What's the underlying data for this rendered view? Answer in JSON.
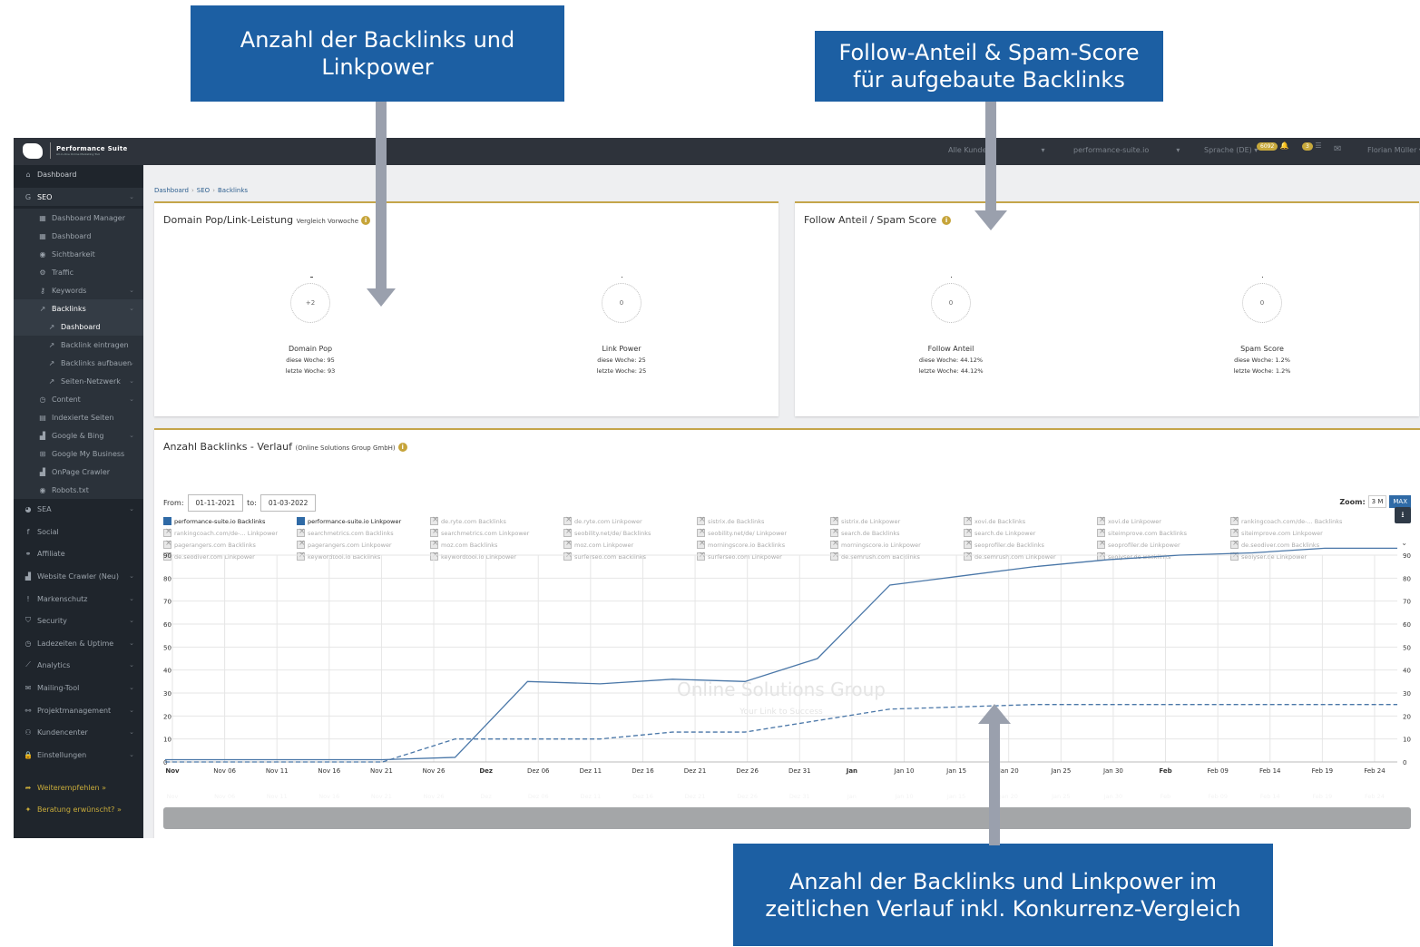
{
  "callouts": {
    "top_left": [
      "Anzahl der Backlinks und",
      "Linkpower"
    ],
    "top_right": [
      "Follow-Anteil & Spam-Score",
      "für aufgebaute Backlinks"
    ],
    "bottom": [
      "Anzahl der Backlinks und Linkpower im",
      "zeitlichen Verlauf inkl. Konkurrenz-Vergleich"
    ]
  },
  "topbar": {
    "logo_text": "Performance Suite",
    "logo_sub": "All-in-One Online Marketing Tool",
    "customer_select": "Alle Kunden",
    "domain_select": "performance-suite.io",
    "language": "Sprache (DE)",
    "badge_count": "6092",
    "badge_count2": "3",
    "user": "Florian Müller"
  },
  "sidebar": {
    "items": [
      {
        "label": "Dashboard",
        "icon": "home-icon"
      },
      {
        "label": "SEO",
        "icon": "google-icon"
      },
      {
        "label": "Dashboard Manager",
        "icon": "dashboard-icon"
      },
      {
        "label": "Dashboard",
        "icon": "dashboard-icon"
      },
      {
        "label": "Sichtbarkeit",
        "icon": "eye-icon"
      },
      {
        "label": "Traffic",
        "icon": "gears-icon"
      },
      {
        "label": "Keywords",
        "icon": "key-icon"
      },
      {
        "label": "Backlinks",
        "icon": "external-link-icon"
      },
      {
        "label": "Dashboard",
        "icon": "external-link-icon"
      },
      {
        "label": "Backlink eintragen",
        "icon": "external-link-icon"
      },
      {
        "label": "Backlinks aufbauen",
        "icon": "external-link-icon"
      },
      {
        "label": "Seiten-Netzwerk",
        "icon": "external-link-icon"
      },
      {
        "label": "Content",
        "icon": "clock-icon"
      },
      {
        "label": "Indexierte Seiten",
        "icon": "file-icon"
      },
      {
        "label": "Google & Bing",
        "icon": "area-chart-icon"
      },
      {
        "label": "Google My Business",
        "icon": "store-icon"
      },
      {
        "label": "OnPage Crawler",
        "icon": "area-chart-icon"
      },
      {
        "label": "Robots.txt",
        "icon": "eye-icon"
      },
      {
        "label": "SEA",
        "icon": "pie-icon"
      },
      {
        "label": "Social",
        "icon": "facebook-icon"
      },
      {
        "label": "Affiliate",
        "icon": "handshake-icon"
      },
      {
        "label": "Website Crawler (Neu)",
        "icon": "area-chart-icon"
      },
      {
        "label": "Markenschutz",
        "icon": "exclamation-icon"
      },
      {
        "label": "Security",
        "icon": "shield-icon"
      },
      {
        "label": "Ladezeiten & Uptime",
        "icon": "clock-icon"
      },
      {
        "label": "Analytics",
        "icon": "line-chart-icon"
      },
      {
        "label": "Mailing-Tool",
        "icon": "envelope-icon"
      },
      {
        "label": "Projektmanagement",
        "icon": "sitemap-icon"
      },
      {
        "label": "Kundencenter",
        "icon": "users-icon"
      },
      {
        "label": "Einstellungen",
        "icon": "lock-icon"
      },
      {
        "label": "Weiterempfehlen »",
        "icon": "share-icon"
      },
      {
        "label": "Beratung erwünscht? »",
        "icon": "chat-icon"
      }
    ]
  },
  "breadcrumb": [
    "Dashboard",
    "SEO",
    "Backlinks"
  ],
  "panel_linkpower": {
    "title": "Domain Pop/Link-Leistung",
    "subtitle": "Vergleich Vorwoche",
    "kpis": [
      {
        "gauge": "+2",
        "name": "Domain Pop",
        "this_week": "diese Woche: 95",
        "last_week": "letzte Woche: 93"
      },
      {
        "gauge": "0",
        "name": "Link Power",
        "this_week": "diese Woche: 25",
        "last_week": "letzte Woche: 25"
      }
    ]
  },
  "panel_follow": {
    "title": "Follow Anteil / Spam Score",
    "kpis": [
      {
        "gauge": "0",
        "name": "Follow Anteil",
        "this_week": "diese Woche: 44.12%",
        "last_week": "letzte Woche: 44.12%"
      },
      {
        "gauge": "0",
        "name": "Spam Score",
        "this_week": "diese Woche: 1.2%",
        "last_week": "letzte Woche: 1.2%"
      }
    ]
  },
  "panel_history": {
    "title": "Anzahl Backlinks - Verlauf",
    "subtitle": "(Online Solutions Group GmbH)",
    "from_label": "From:",
    "from_value": "01-11-2021",
    "to_label": "to:",
    "to_value": "01-03-2022",
    "zoom_label": "Zoom:",
    "zoom_options": [
      "3 M",
      "MAX"
    ],
    "watermark": "Online Solutions Group",
    "watermark_sub": "Your Link to Success",
    "legend": [
      "performance-suite.io Backlinks",
      "performance-suite.io Linkpower",
      "de.ryte.com Backlinks",
      "de.ryte.com Linkpower",
      "sistrix.de Backlinks",
      "sistrix.de Linkpower",
      "xovi.de Backlinks",
      "xovi.de Linkpower",
      "rankingcoach.com/de-... Backlinks",
      "rankingcoach.com/de-... Linkpower",
      "searchmetrics.com Backlinks",
      "searchmetrics.com Linkpower",
      "seobility.net/de/ Backlinks",
      "seobility.net/de/ Linkpower",
      "search.de Backlinks",
      "search.de Linkpower",
      "siteimprove.com Backlinks",
      "siteimprove.com Linkpower",
      "pagerangers.com Backlinks",
      "pagerangers.com Linkpower",
      "moz.com Backlinks",
      "moz.com Linkpower",
      "morningscore.io Backlinks",
      "morningscore.io Linkpower",
      "seoprofiler.de Backlinks",
      "seoprofiler.de Linkpower",
      "de.seodiver.com Backlinks",
      "de.seodiver.com Linkpower",
      "keywordtool.io Backlinks",
      "keywordtool.io Linkpower",
      "surferseo.com Backlinks",
      "surferseo.com Linkpower",
      "de.semrush.com Backlinks",
      "de.semrush.com Linkpower",
      "seolyser.de Backlinks",
      "seolyser.de Linkpower"
    ]
  },
  "chart_data": {
    "type": "line",
    "ylim": [
      0,
      90
    ],
    "yticks": [
      0,
      10,
      20,
      30,
      40,
      50,
      60,
      70,
      80,
      90
    ],
    "x_tick_labels": [
      "Nov",
      "Nov 06",
      "Nov 11",
      "Nov 16",
      "Nov 21",
      "Nov 26",
      "Dez",
      "Dez 06",
      "Dez 11",
      "Dez 16",
      "Dez 21",
      "Dez 26",
      "Dez 31",
      "Jan",
      "Jan 10",
      "Jan 15",
      "Jan 20",
      "Jan 25",
      "Jan 30",
      "Feb",
      "Feb 09",
      "Feb 14",
      "Feb 19",
      "Feb 24"
    ],
    "bold_ticks": [
      "Nov",
      "Dez",
      "Jan",
      "Feb"
    ],
    "x": [
      "2021-11-01",
      "2021-11-08",
      "2021-11-15",
      "2021-11-22",
      "2021-11-29",
      "2021-12-06",
      "2021-12-13",
      "2021-12-20",
      "2021-12-27",
      "2022-01-03",
      "2022-01-10",
      "2022-01-17",
      "2022-01-24",
      "2022-01-31",
      "2022-02-07",
      "2022-02-14",
      "2022-02-21",
      "2022-02-28"
    ],
    "series": [
      {
        "name": "performance-suite.io Backlinks",
        "style": "solid",
        "values": [
          1,
          1,
          1,
          1,
          2,
          35,
          34,
          36,
          35,
          45,
          77,
          81,
          85,
          88,
          90,
          91,
          93,
          93
        ]
      },
      {
        "name": "performance-suite.io Linkpower",
        "style": "dashed",
        "values": [
          0,
          0,
          0,
          0,
          10,
          10,
          10,
          13,
          13,
          18,
          23,
          24,
          25,
          25,
          25,
          25,
          25,
          25
        ]
      }
    ],
    "colors": {
      "line": "#4a77a8",
      "grid": "#e6e6e6"
    }
  }
}
